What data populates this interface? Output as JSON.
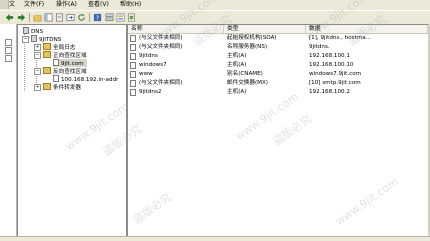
{
  "menu": {
    "file_short": "文",
    "items": [
      "文件(F)",
      "操作(A)",
      "查看(V)",
      "帮助(H)"
    ]
  },
  "tree": {
    "root": "DNS",
    "server": "9JITDNS",
    "global_logs": "全局日志",
    "forward_zones": "正向查找区域",
    "forward_zone_item": "9jit.com",
    "reverse_zones": "反向查找区域",
    "reverse_zone_item": "100.168.192.in-addr",
    "conditional_forwarders": "条件转发器"
  },
  "list": {
    "headers": [
      "名称",
      "类型",
      "数据"
    ],
    "rows": [
      {
        "name": "(与父文件夹相同)",
        "type": "起始授权机构(SOA)",
        "data": "[1], 9jitdns., hostma..."
      },
      {
        "name": "(与父文件夹相同)",
        "type": "名称服务器(NS)",
        "data": "9jitdns."
      },
      {
        "name": "9jitdns",
        "type": "主机(A)",
        "data": "192.168.100.1"
      },
      {
        "name": "windows7",
        "type": "主机(A)",
        "data": "192.168.100.10"
      },
      {
        "name": "www",
        "type": "别名(CNAME)",
        "data": "windows7.9jit.com"
      },
      {
        "name": "(与父文件夹相同)",
        "type": "邮件交换器(MX)",
        "data": "[10]  smtp.9jit.com"
      },
      {
        "name": "9jitdns2",
        "type": "主机(A)",
        "data": "192.168.100.2"
      }
    ]
  },
  "watermark": {
    "site": "www.9jit.com",
    "text": "盗版必究"
  },
  "colors": {
    "back_arrow": "#2a7d2e",
    "forward_arrow": "#2a7d2e",
    "folder": "#e8c45a",
    "toolbar_bg": "#ece9d8"
  }
}
